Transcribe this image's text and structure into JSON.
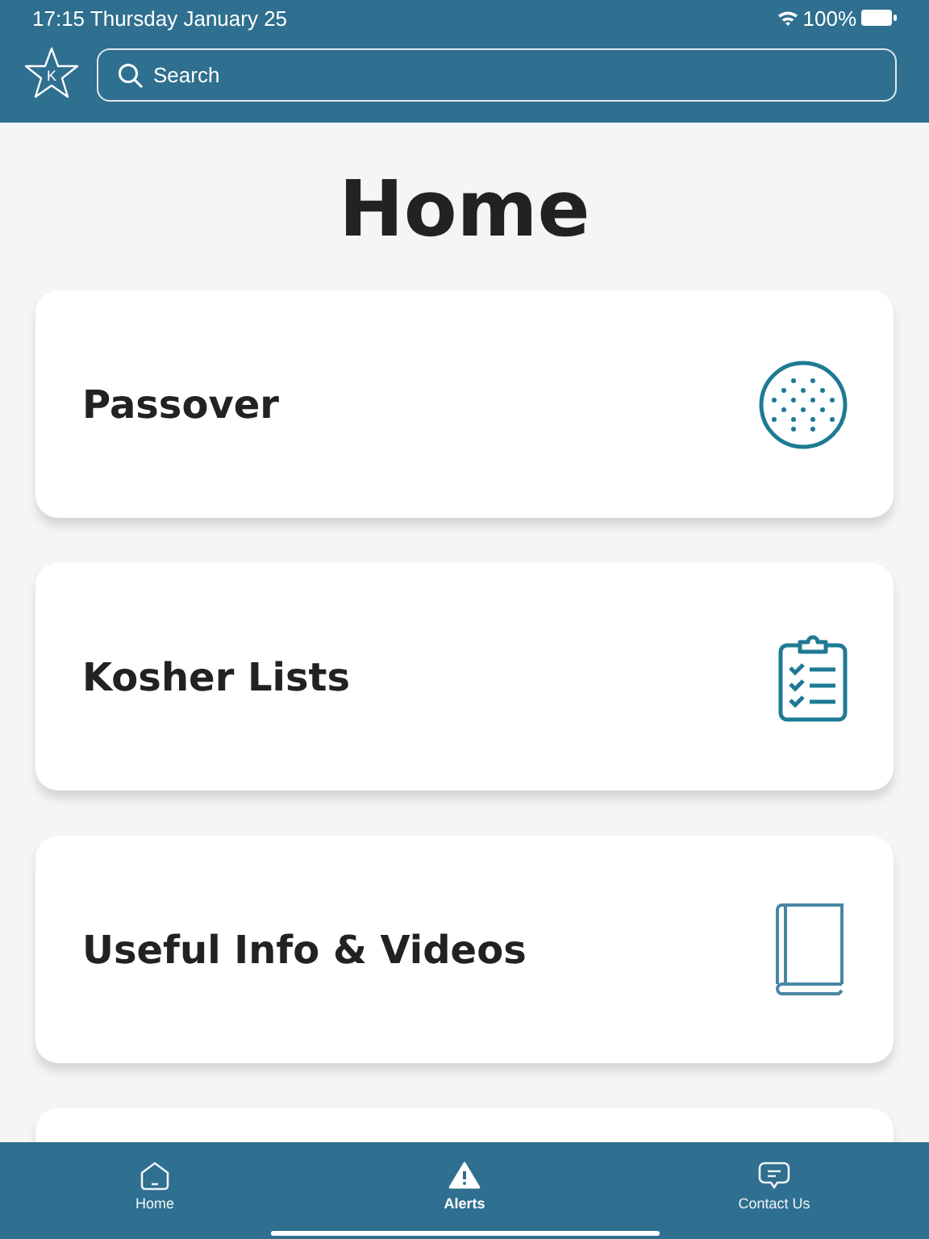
{
  "status_bar": {
    "time": "17:15 Thursday January 25",
    "battery": "100%"
  },
  "header": {
    "logo_letter": "K",
    "search": {
      "placeholder": "Search"
    }
  },
  "title": "Home",
  "cards": [
    {
      "title": "Passover",
      "kind": "matzah"
    },
    {
      "title": "Kosher Lists",
      "kind": "checklist"
    },
    {
      "title": "Useful Info & Videos",
      "kind": "book"
    }
  ],
  "tab_bar": [
    {
      "label": "Home",
      "kind": "home",
      "selected": false
    },
    {
      "label": "Alerts",
      "kind": "alert",
      "selected": true
    },
    {
      "label": "Contact Us",
      "kind": "chat",
      "selected": false
    }
  ]
}
